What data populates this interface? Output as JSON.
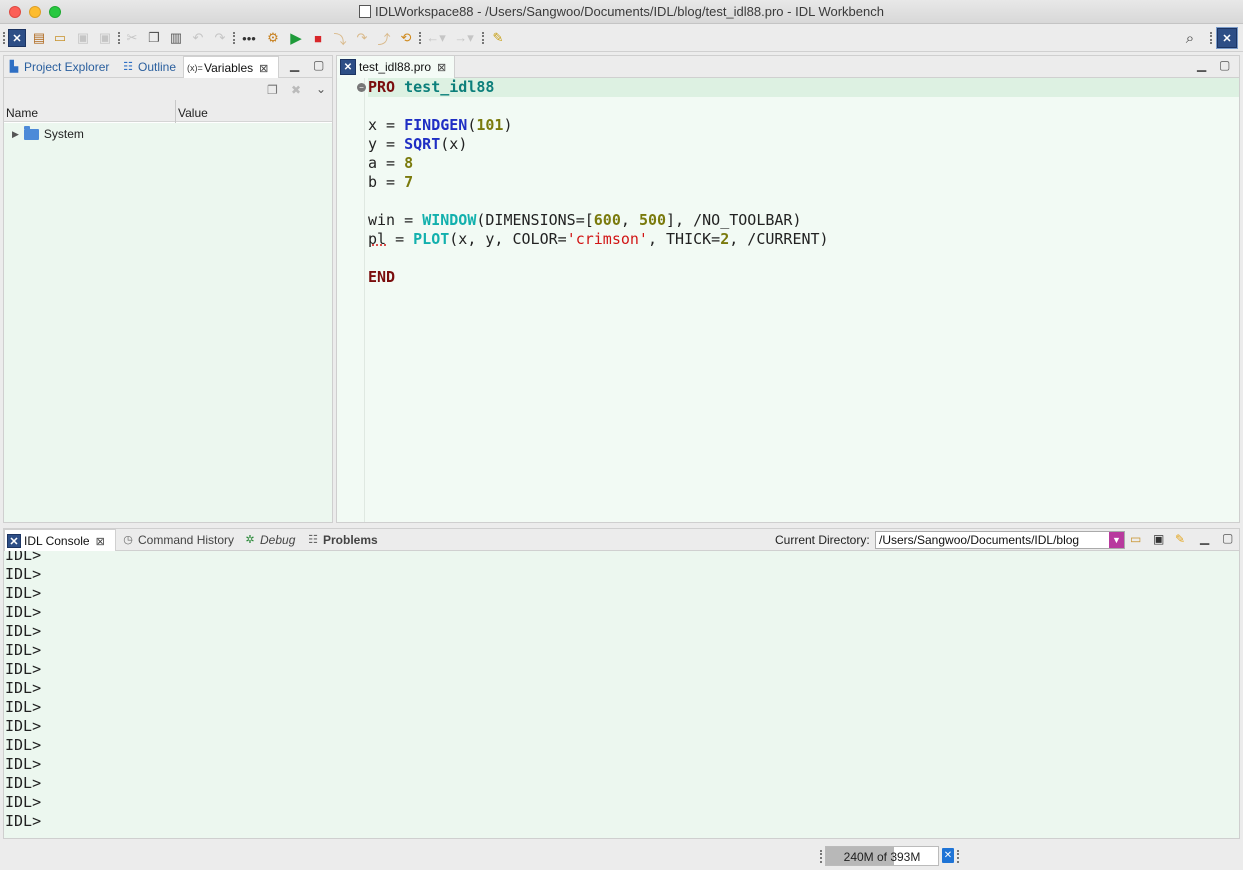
{
  "window": {
    "title": "IDLWorkspace88 - /Users/Sangwoo/Documents/IDL/blog/test_idl88.pro - IDL Workbench"
  },
  "toolbar": {
    "icons": [
      "idl-perspective-icon",
      "new-file-icon",
      "open-file-icon",
      "save-icon",
      "save-all-icon",
      "cut-icon",
      "copy-icon",
      "paste-icon",
      "undo-icon",
      "redo-icon",
      "breakpoint-icon",
      "compile-icon",
      "run-icon",
      "stop-icon",
      "step-into-icon",
      "step-over-icon",
      "step-out-icon",
      "reset-icon",
      "back-icon",
      "forward-icon",
      "pin-icon",
      "search-icon",
      "idl-perspective-active-icon"
    ]
  },
  "left_panel": {
    "tabs": [
      {
        "label": "Project Explorer",
        "icon": "project-explorer-icon"
      },
      {
        "label": "Outline",
        "icon": "outline-icon"
      },
      {
        "label": "Variables",
        "icon": "variables-icon",
        "active": true
      }
    ],
    "variables": {
      "columns": [
        "Name",
        "Value"
      ],
      "rows": [
        {
          "name": "System",
          "value": "",
          "expanded": false
        }
      ]
    }
  },
  "editor": {
    "tab_label": "test_idl88.pro",
    "lines": {
      "pro_keyword": "PRO",
      "proc_name": "test_idl88",
      "l3_var": "x",
      "l3_fn": "FINDGEN",
      "l3_arg": "101",
      "l4_var": "y",
      "l4_fn": "SQRT",
      "l4_arg": "x",
      "l5_var": "a",
      "l5_val": "8",
      "l6_var": "b",
      "l6_val": "7",
      "l8_var": "win",
      "l8_fn": "WINDOW",
      "l8_kw": "DIMENSIONS=[",
      "l8_n1": "600",
      "l8_n2": "500",
      "l8_rest": "], /NO_TOOLBAR)",
      "l9_var": "pl",
      "l9_fn": "PLOT",
      "l9_args": "(x, y, COLOR=",
      "l9_str": "'crimson'",
      "l9_mid": ", THICK=",
      "l9_num": "2",
      "l9_rest": ", /CURRENT)",
      "end_keyword": "END"
    }
  },
  "console": {
    "tabs": [
      {
        "label": "IDL Console",
        "active": true
      },
      {
        "label": "Command History"
      },
      {
        "label": "Debug"
      },
      {
        "label": "Problems"
      }
    ],
    "current_directory_label": "Current Directory:",
    "current_directory": "/Users/Sangwoo/Documents/IDL/blog",
    "prompt": "IDL>",
    "prompt_lines": [
      "IDL>",
      "IDL>",
      "IDL>",
      "IDL>",
      "IDL>",
      "IDL>",
      "IDL>",
      "IDL>",
      "IDL>",
      "IDL>",
      "IDL>",
      "IDL>",
      "IDL>",
      "IDL>",
      "IDL>"
    ]
  },
  "status": {
    "heap_text": "240M of 393M",
    "heap_used_fraction": 0.61
  }
}
